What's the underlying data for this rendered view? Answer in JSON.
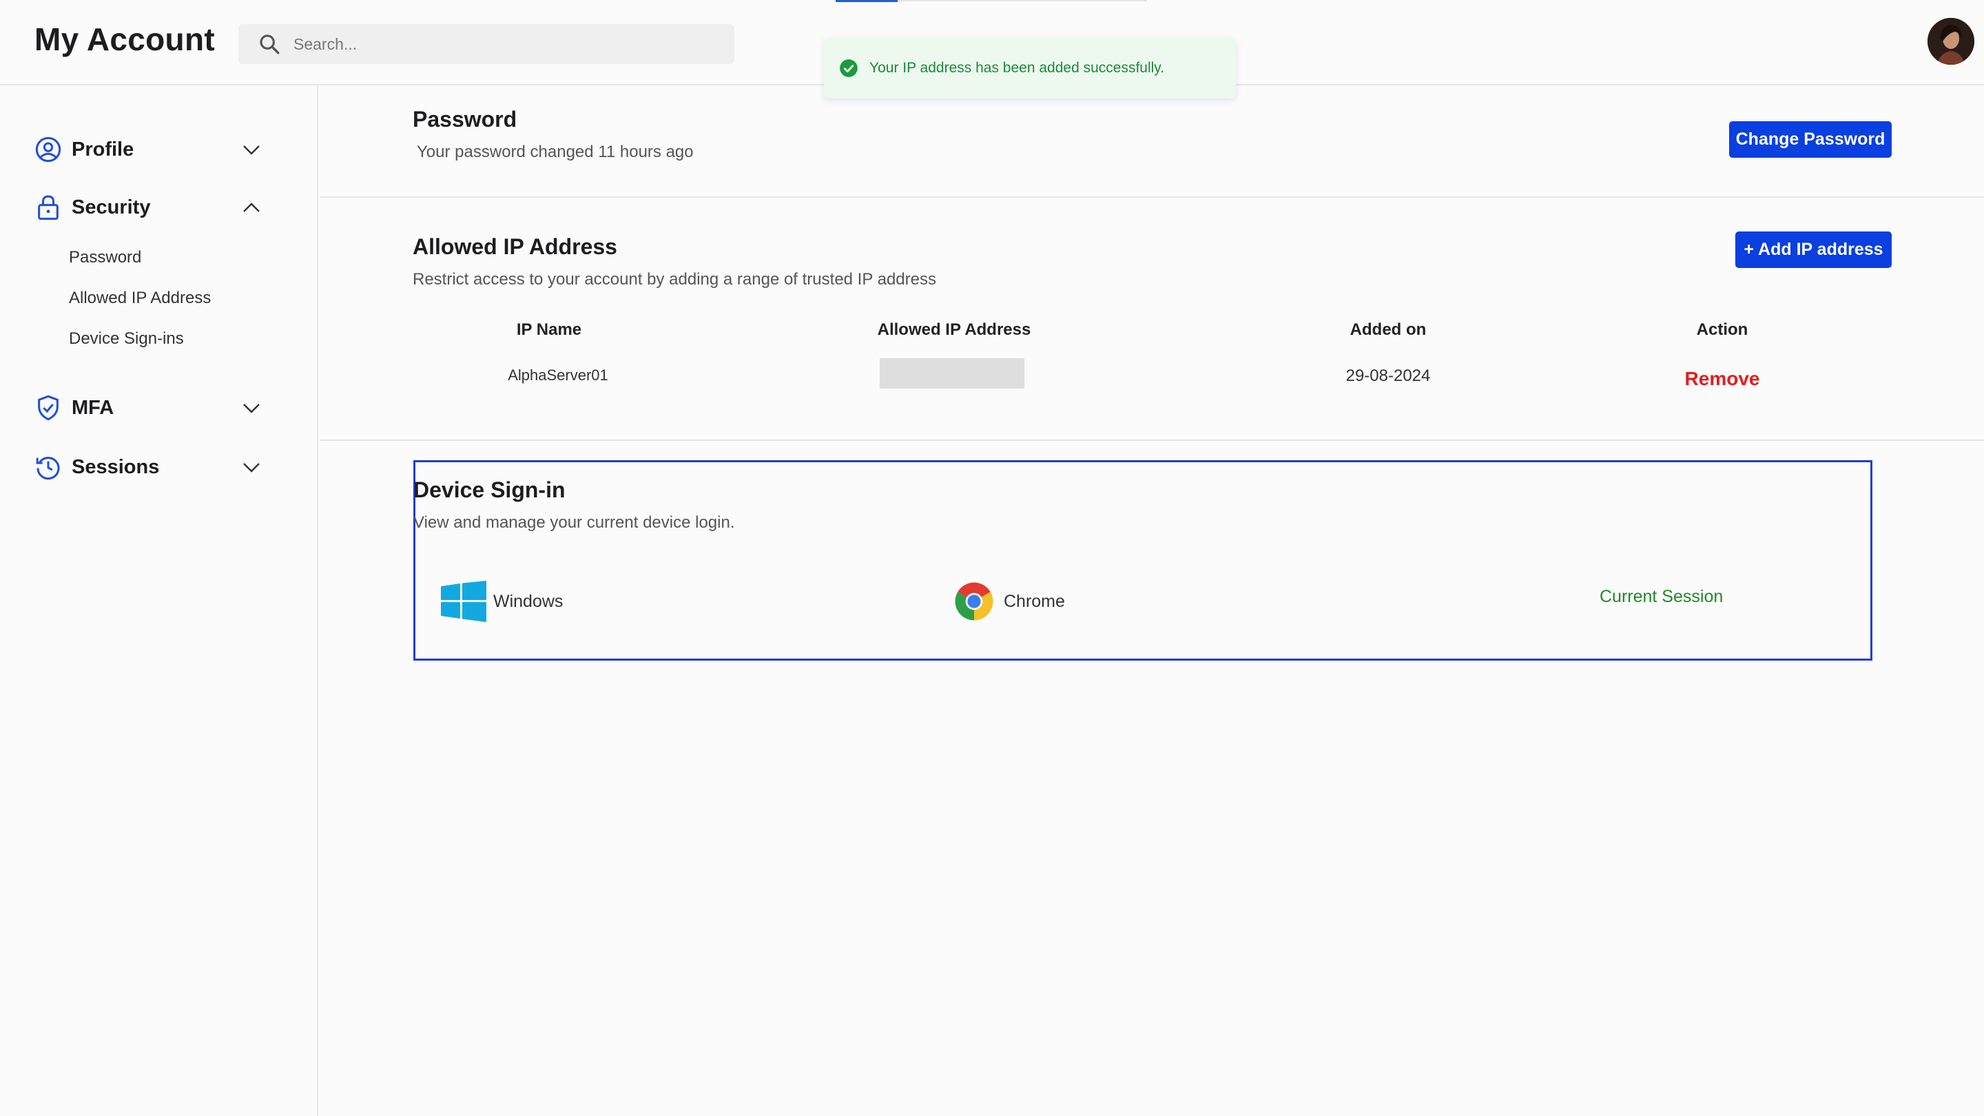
{
  "header": {
    "title": "My Account",
    "search_placeholder": "Search..."
  },
  "toast": {
    "message": "Your IP address has been added successfully.",
    "status_color": "#1b8a3a"
  },
  "sidebar": {
    "items": [
      {
        "label": "Profile",
        "icon": "user-circle-icon",
        "expanded": false
      },
      {
        "label": "Security",
        "icon": "lock-icon",
        "expanded": true,
        "subitems": [
          "Password",
          "Allowed IP Address",
          "Device Sign-ins"
        ]
      },
      {
        "label": "MFA",
        "icon": "shield-check-icon",
        "expanded": false
      },
      {
        "label": "Sessions",
        "icon": "history-icon",
        "expanded": false
      }
    ]
  },
  "password_section": {
    "title": "Password",
    "subtitle": "Your password changed 11 hours ago",
    "button_label": "Change Password"
  },
  "ip_section": {
    "title": "Allowed IP Address",
    "subtitle": "Restrict access to your account by adding a range of trusted IP address",
    "button_label": "+ Add IP address",
    "columns": [
      "IP Name",
      "Allowed IP Address",
      "Added on",
      "Action"
    ],
    "rows": [
      {
        "ip_name": "AlphaServer01",
        "ip_address": "",
        "added_on": "29-08-2024",
        "action": "Remove"
      }
    ]
  },
  "device_section": {
    "title": "Device Sign-in",
    "subtitle": "View and manage your current device login.",
    "devices": [
      {
        "os": "Windows",
        "browser": "Chrome",
        "status": "Current Session"
      }
    ]
  },
  "colors": {
    "accent": "#0a3fe0",
    "danger": "#e11d1d",
    "success": "#1e8a26",
    "card_border": "#1f3fd0"
  }
}
